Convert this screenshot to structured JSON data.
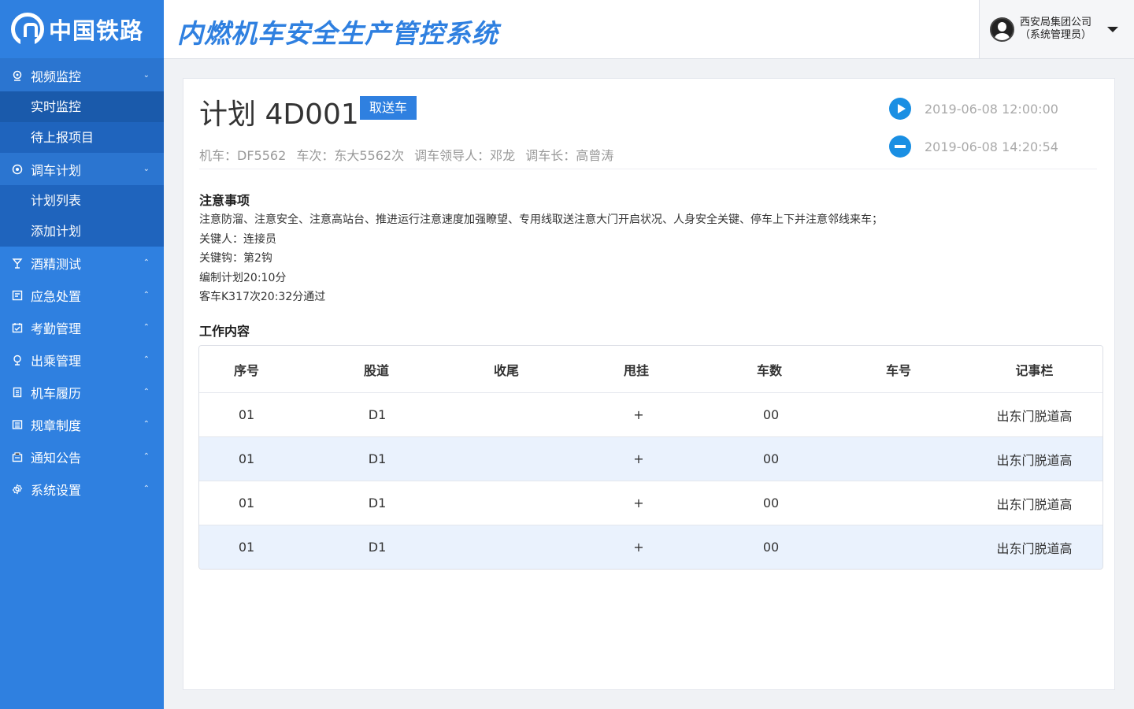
{
  "brand": {
    "logo_text": "中国铁路"
  },
  "header": {
    "system_title": "内燃机车安全生产管控系统",
    "user_org": "西安局集团公司",
    "user_role": "（系统管理员）"
  },
  "sidebar": {
    "groups": [
      {
        "label": "视频监控",
        "icon": "camera-icon",
        "expanded": true,
        "chevron": "⌄",
        "children": [
          {
            "label": "实时监控"
          },
          {
            "label": "待上报项目"
          }
        ]
      },
      {
        "label": "调车计划",
        "icon": "dispatch-icon",
        "expanded": true,
        "chevron": "⌄",
        "children": [
          {
            "label": "计划列表"
          },
          {
            "label": "添加计划"
          }
        ]
      },
      {
        "label": "酒精测试",
        "icon": "cup-icon",
        "chevron": "⌃"
      },
      {
        "label": "应急处置",
        "icon": "emergency-icon",
        "chevron": "⌃"
      },
      {
        "label": "考勤管理",
        "icon": "calendar-icon",
        "chevron": "⌃"
      },
      {
        "label": "出乘管理",
        "icon": "location-icon",
        "chevron": "⌃"
      },
      {
        "label": "机车履历",
        "icon": "document-icon",
        "chevron": "⌃"
      },
      {
        "label": "规章制度",
        "icon": "rules-icon",
        "chevron": "⌃"
      },
      {
        "label": "通知公告",
        "icon": "notice-icon",
        "chevron": "⌃"
      },
      {
        "label": "系统设置",
        "icon": "gear-icon",
        "chevron": "⌃"
      }
    ]
  },
  "plan": {
    "title": "计划 4D001",
    "tag": "取送车",
    "meta": {
      "loco": "机车：DF5562",
      "train_no": "车次：东大5562次",
      "leader": "调车领导人：邓龙",
      "chief": "调车长：高曾涛"
    },
    "start_time": "2019-06-08 12:00:00",
    "end_time": "2019-06-08 14:20:54"
  },
  "notes": {
    "title": "注意事项",
    "lines": [
      "注意防溜、注意安全、注意高站台、推进运行注意速度加强瞭望、专用线取送注意大门开启状况、人身安全关键、停车上下并注意邻线来车；",
      "关键人：连接员",
      "关键钩：第2钩",
      "编制计划20:10分",
      "客车K317次20:32分通过"
    ]
  },
  "work": {
    "title": "工作内容",
    "columns": [
      "序号",
      "股道",
      "收尾",
      "甩挂",
      "车数",
      "车号",
      "记事栏"
    ],
    "rows": [
      [
        "01",
        "D1",
        "",
        "+",
        "00",
        "",
        "出东门脱道高"
      ],
      [
        "01",
        "D1",
        "",
        "+",
        "00",
        "",
        "出东门脱道高"
      ],
      [
        "01",
        "D1",
        "",
        "+",
        "00",
        "",
        "出东门脱道高"
      ],
      [
        "01",
        "D1",
        "",
        "+",
        "00",
        "",
        "出东门脱道高"
      ]
    ]
  }
}
